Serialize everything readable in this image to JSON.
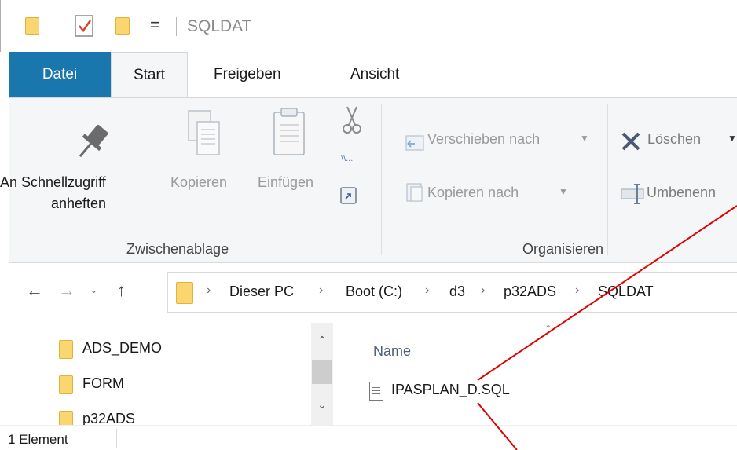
{
  "window": {
    "title": "SQLDAT",
    "qat_dropdown_glyph": "="
  },
  "ribbon_tabs": [
    {
      "label": "Datei"
    },
    {
      "label": "Start"
    },
    {
      "label": "Freigeben"
    },
    {
      "label": "Ansicht"
    }
  ],
  "clipboard": {
    "pin_label_line1": "An Schnellzugriff",
    "pin_label_line2": "anheften",
    "copy_label": "Kopieren",
    "paste_label": "Einfügen",
    "group_label": "Zwischenablage"
  },
  "organize": {
    "move_to_label": "Verschieben nach",
    "copy_to_label": "Kopieren nach",
    "delete_label": "Löschen",
    "rename_label": "Umbenenn",
    "group_label": "Organisieren"
  },
  "address": {
    "crumbs": [
      "Dieser PC",
      "Boot (C:)",
      "d3",
      "p32ADS",
      "SQLDAT"
    ]
  },
  "nav_tree": [
    {
      "label": "ADS_DEMO"
    },
    {
      "label": "FORM"
    },
    {
      "label": "p32ADS"
    }
  ],
  "file_list": {
    "column_name": "Name",
    "files": [
      {
        "name": "IPASPLAN_D.SQL"
      }
    ]
  },
  "status": {
    "count_text": "1 Element"
  },
  "colors": {
    "datei_tab": "#1a77ad",
    "folder_yellow": "#f9d66f",
    "annotation_red": "#e00000"
  }
}
